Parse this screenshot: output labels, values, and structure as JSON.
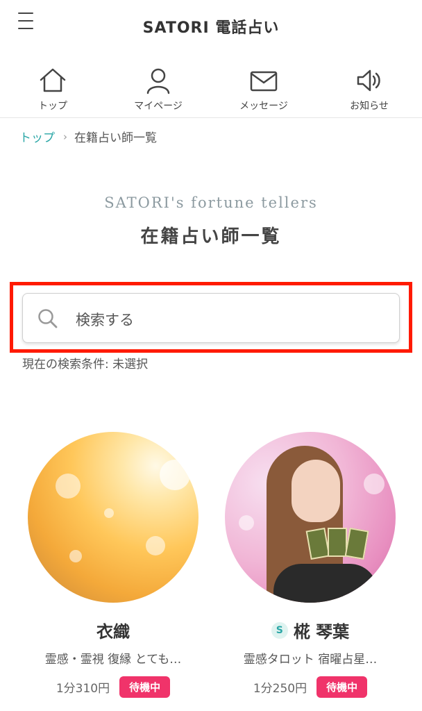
{
  "header": {
    "logo": "SATORI 電話占い"
  },
  "nav": {
    "items": [
      {
        "label": "トップ",
        "icon": "home-icon"
      },
      {
        "label": "マイページ",
        "icon": "user-icon"
      },
      {
        "label": "メッセージ",
        "icon": "mail-icon"
      },
      {
        "label": "お知らせ",
        "icon": "speaker-icon"
      }
    ]
  },
  "breadcrumb": {
    "home": "トップ",
    "current": "在籍占い師一覧"
  },
  "page": {
    "subtitle": "SATORI's fortune tellers",
    "title": "在籍占い師一覧"
  },
  "search": {
    "placeholder": "検索する",
    "condition": "現在の検索条件: 未選択"
  },
  "tellers": [
    {
      "name": "衣織",
      "badge": "",
      "description": "霊感・霊視 復縁 とても…",
      "price": "1分310円",
      "status": "待機中"
    },
    {
      "name": "椛 琴葉",
      "badge": "S",
      "description": "霊感タロット 宿曜占星…",
      "price": "1分250円",
      "status": "待機中"
    }
  ],
  "colors": {
    "accent": "#2aa6a6",
    "status": "#f0336a",
    "highlight": "#ff1a00"
  }
}
